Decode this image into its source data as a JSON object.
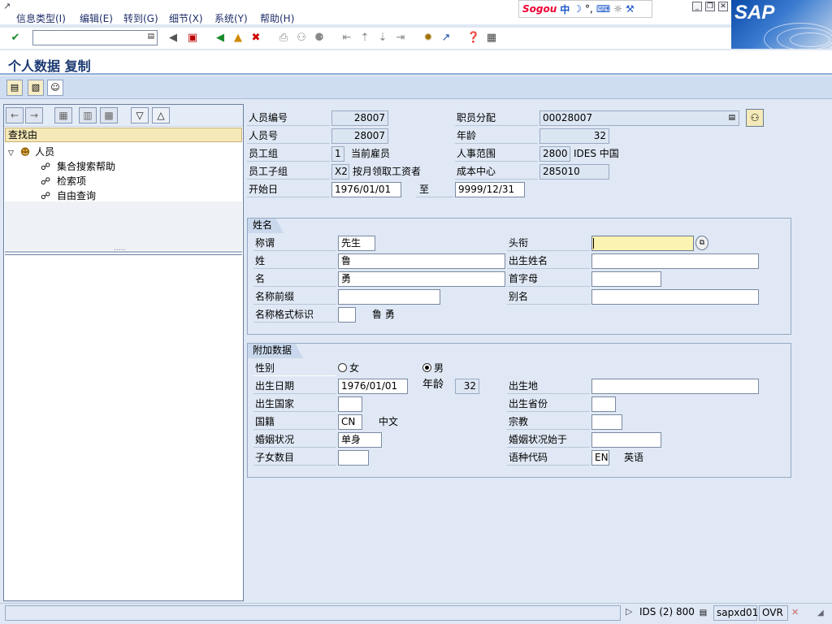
{
  "menu": {
    "items": [
      "信息类型(I)",
      "编辑(E)",
      "转到(G)",
      "细节(X)",
      "系统(Y)",
      "帮助(H)"
    ],
    "ime": {
      "brand": "Sogou",
      "mode": "中",
      "extra": "°,"
    }
  },
  "toolbar": {
    "command_value": ""
  },
  "title": "个人数据 复制",
  "left": {
    "find_by": "查找由",
    "tree_root": "人员",
    "tree_items": [
      "集合搜索帮助",
      "检索项",
      "自由查询"
    ]
  },
  "header": {
    "pernr_label": "人员编号",
    "pernr_value": "28007",
    "pnum_label": "人员号",
    "pnum_value": "28007",
    "eegroup_label": "员工组",
    "eegroup_code": "1",
    "eegroup_text": "当前雇员",
    "eesub_label": "员工子组",
    "eesub_code": "X2",
    "eesub_text": "按月领取工资者",
    "start_label": "开始日",
    "start_value": "1976/01/01",
    "to_label": "至",
    "end_value": "9999/12/31",
    "assign_label": "职员分配",
    "assign_value": "00028007",
    "age_label": "年龄",
    "age_value": "32",
    "parea_label": "人事范围",
    "parea_code": "2800",
    "parea_text": "IDES 中国",
    "cost_label": "成本中心",
    "cost_value": "285010"
  },
  "name_group": {
    "title": "姓名",
    "salutation_label": "称谓",
    "salutation_value": "先生",
    "last_label": "姓",
    "last_value": "鲁",
    "first_label": "名",
    "first_value": "勇",
    "prefix_label": "名称前缀",
    "prefix_value": "",
    "format_label": "名称格式标识",
    "format_value": "",
    "format_preview": "鲁 勇",
    "title_label": "头衔",
    "title_value": "",
    "birthname_label": "出生姓名",
    "birthname_value": "",
    "initials_label": "首字母",
    "initials_value": "",
    "alias_label": "别名",
    "alias_value": ""
  },
  "extra_group": {
    "title": "附加数据",
    "gender_label": "性别",
    "female": "女",
    "male": "男",
    "gender_selected": "male",
    "dob_label": "出生日期",
    "dob_value": "1976/01/01",
    "age_label": "年龄",
    "age_value": "32",
    "birthplace_label": "出生地",
    "birthplace_value": "",
    "country_label": "出生国家",
    "country_value": "",
    "province_label": "出生省份",
    "province_value": "",
    "nationality_label": "国籍",
    "nationality_code": "CN",
    "nationality_text": "中文",
    "religion_label": "宗教",
    "religion_value": "",
    "marital_label": "婚姻状况",
    "marital_value": "单身",
    "marital_since_label": "婚姻状况始于",
    "marital_since_value": "",
    "children_label": "子女数目",
    "children_value": "",
    "lang_label": "语种代码",
    "lang_code": "EN",
    "lang_text": "英语"
  },
  "status": {
    "system": "IDS (2) 800",
    "server": "sapxd01",
    "mode": "OVR"
  }
}
